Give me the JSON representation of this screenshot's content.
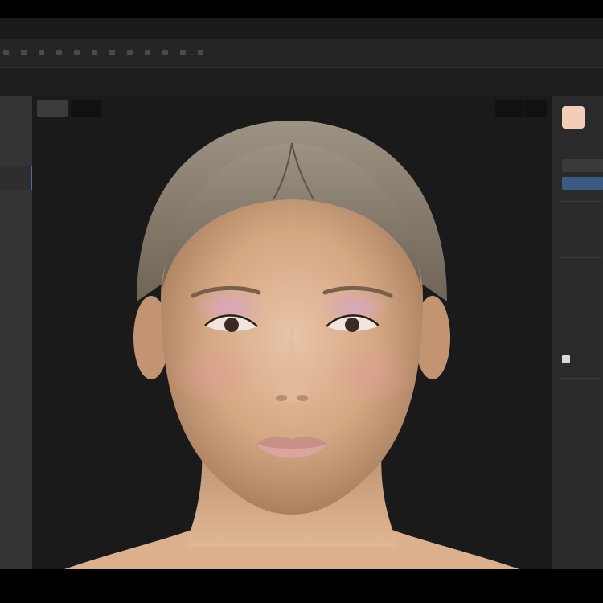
{
  "window": {
    "app_title": "",
    "subtitle": ""
  },
  "menubar": {
    "items": [
      "",
      "",
      "",
      "",
      "",
      "",
      "",
      "",
      "",
      "",
      "",
      "",
      "",
      ""
    ]
  },
  "subbar": {
    "label": ""
  },
  "viewport": {
    "tool_1": "",
    "tool_2": "",
    "tool_3": "",
    "tool_4": ""
  },
  "right_panel": {
    "swatch_color": "#f2cdb8",
    "accent_color": "#3b5a82",
    "labels": [
      "",
      "",
      "",
      "",
      ""
    ]
  },
  "colors": {
    "app_background": "#1f1f1f",
    "viewport_background": "#1a1a1a",
    "panel_background": "#2a2a2a",
    "selection_accent": "#3f6fa8"
  }
}
